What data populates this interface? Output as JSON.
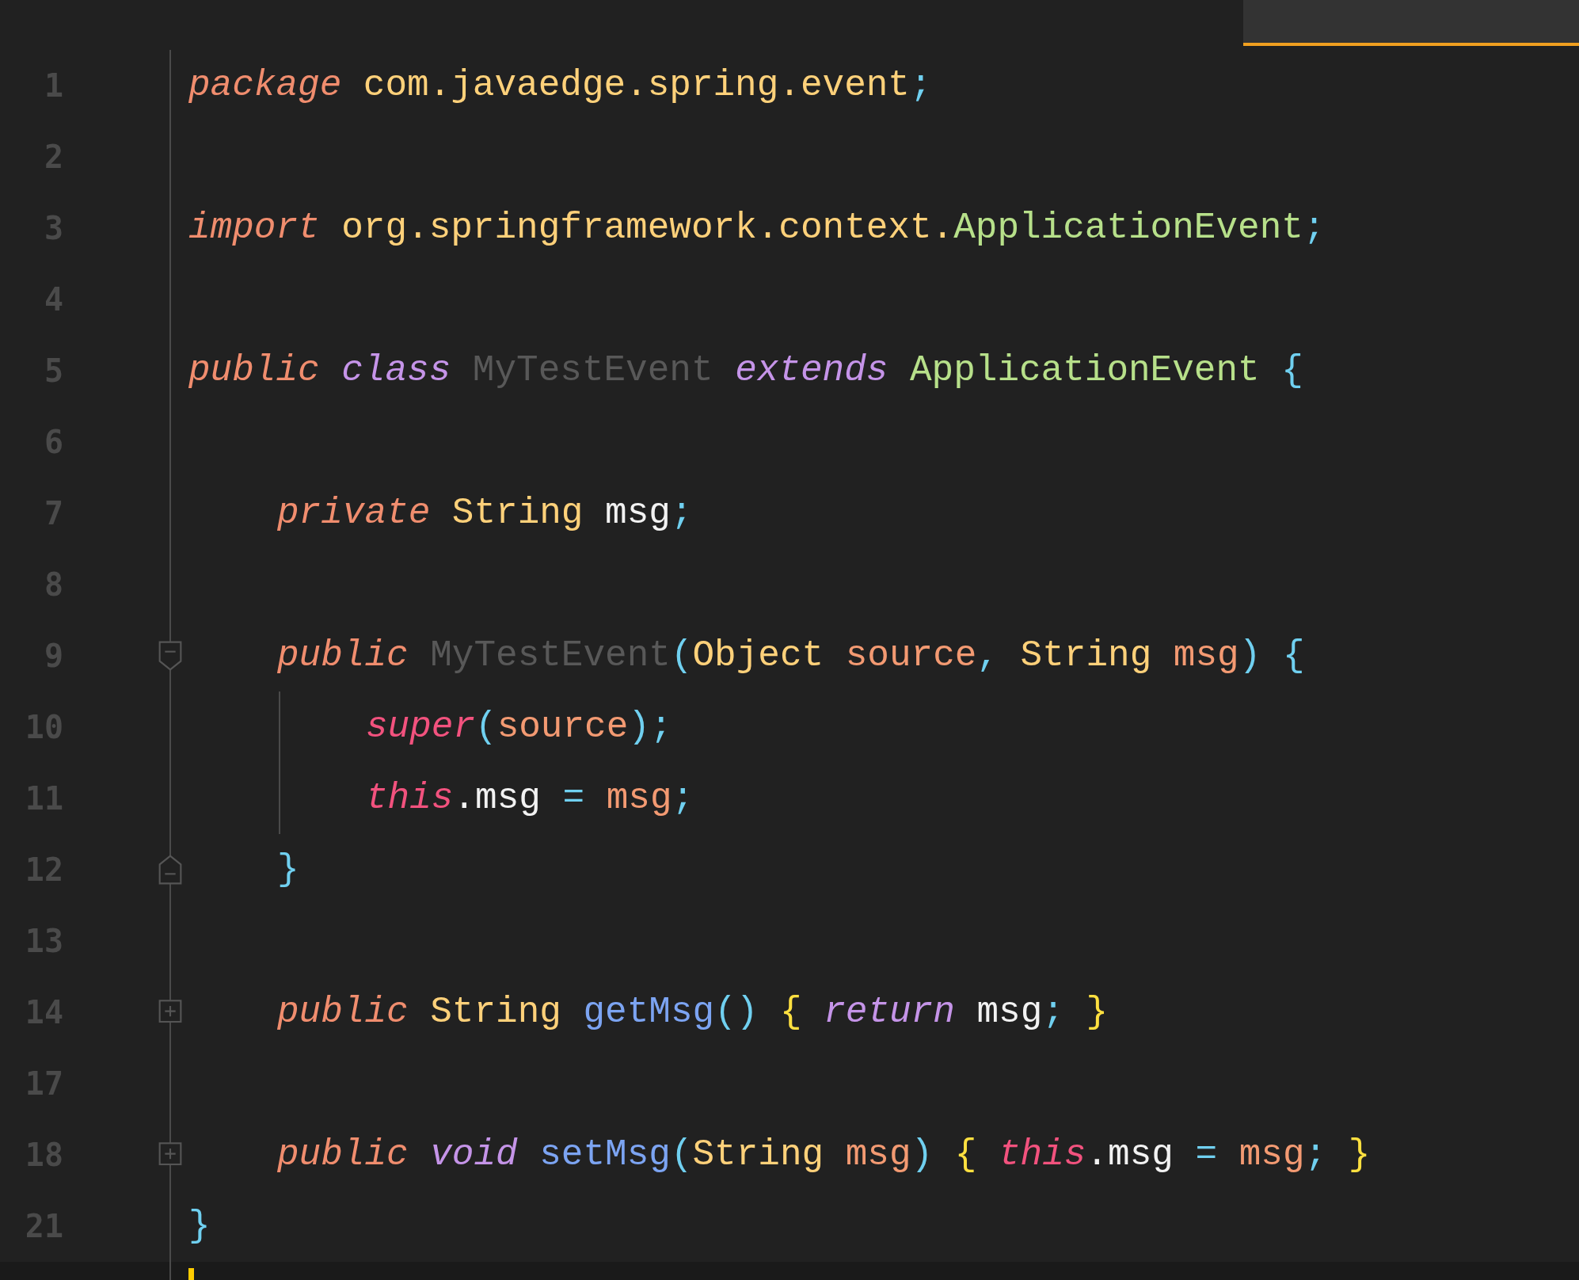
{
  "tab": {
    "selected": true
  },
  "lines": [
    {
      "number": "1",
      "tokens": [
        {
          "text": "package",
          "kind": "keyword"
        },
        {
          "text": " com.javaedge.spring.event",
          "kind": "type"
        },
        {
          "text": ";",
          "kind": "punct"
        }
      ]
    },
    {
      "number": "2"
    },
    {
      "number": "3",
      "tokens": [
        {
          "text": "import",
          "kind": "keyword"
        },
        {
          "text": " org.springframework.context.",
          "kind": "type"
        },
        {
          "text": "ApplicationEvent",
          "kind": "type-green"
        },
        {
          "text": ";",
          "kind": "punct"
        }
      ]
    },
    {
      "number": "4"
    },
    {
      "number": "5",
      "tokens": [
        {
          "text": "public ",
          "kind": "keyword"
        },
        {
          "text": "class",
          "kind": "modifier"
        },
        {
          "text": " MyTestEvent ",
          "kind": "dim"
        },
        {
          "text": "extends",
          "kind": "modifier"
        },
        {
          "text": " ApplicationEvent ",
          "kind": "type-green"
        },
        {
          "text": "{",
          "kind": "punct"
        }
      ],
      "children": [
        {
          "number": "6"
        },
        {
          "number": "7",
          "tokens": [
            {
              "text": "private",
              "kind": "keyword"
            },
            {
              "text": " String ",
              "kind": "type"
            },
            {
              "text": "msg",
              "kind": "field"
            },
            {
              "text": ";",
              "kind": "punct"
            }
          ]
        },
        {
          "number": "8"
        },
        {
          "number": "9",
          "kind": "fold-start",
          "tokens": [
            {
              "text": "public",
              "kind": "keyword"
            },
            {
              "text": " MyTestEvent",
              "kind": "dim"
            },
            {
              "text": "(",
              "kind": "punct"
            },
            {
              "text": "Object ",
              "kind": "type"
            },
            {
              "text": "source",
              "kind": "param"
            },
            {
              "text": ", ",
              "kind": "punct"
            },
            {
              "text": "String ",
              "kind": "type"
            },
            {
              "text": "msg",
              "kind": "param"
            },
            {
              "text": ") {",
              "kind": "punct"
            }
          ],
          "children": [
            {
              "number": "10",
              "tokens": [
                {
                  "text": "super",
                  "kind": "self"
                },
                {
                  "text": "(",
                  "kind": "punct"
                },
                {
                  "text": "source",
                  "kind": "param"
                },
                {
                  "text": ");",
                  "kind": "punct"
                }
              ]
            },
            {
              "number": "11",
              "tokens": [
                {
                  "text": "this",
                  "kind": "self"
                },
                {
                  "text": ".msg ",
                  "kind": "field"
                },
                {
                  "text": "= ",
                  "kind": "punct"
                },
                {
                  "text": "msg",
                  "kind": "param"
                },
                {
                  "text": ";",
                  "kind": "punct"
                }
              ]
            }
          ]
        },
        {
          "number": "12",
          "kind": "fold-end",
          "tokens": [
            {
              "text": "}",
              "kind": "punct"
            }
          ]
        },
        {
          "number": "13"
        },
        {
          "number": "14",
          "kind": "folded",
          "tokens": [
            {
              "text": "public",
              "kind": "keyword"
            },
            {
              "text": " String ",
              "kind": "type"
            },
            {
              "text": "getMsg",
              "kind": "method"
            },
            {
              "text": "() ",
              "kind": "punct"
            },
            {
              "text": "{ ",
              "kind": "brace"
            },
            {
              "text": "return",
              "kind": "modifier"
            },
            {
              "text": " msg",
              "kind": "field"
            },
            {
              "text": "; ",
              "kind": "punct"
            },
            {
              "text": "}",
              "kind": "brace"
            }
          ]
        },
        {
          "number": "17"
        },
        {
          "number": "18",
          "kind": "folded",
          "tokens": [
            {
              "text": "public ",
              "kind": "keyword"
            },
            {
              "text": "void",
              "kind": "modifier"
            },
            {
              "text": " setMsg",
              "kind": "method"
            },
            {
              "text": "(",
              "kind": "punct"
            },
            {
              "text": "String ",
              "kind": "type"
            },
            {
              "text": "msg",
              "kind": "param"
            },
            {
              "text": ") ",
              "kind": "punct"
            },
            {
              "text": "{ ",
              "kind": "brace"
            },
            {
              "text": "this",
              "kind": "self"
            },
            {
              "text": ".msg ",
              "kind": "field"
            },
            {
              "text": "= ",
              "kind": "punct"
            },
            {
              "text": "msg",
              "kind": "param"
            },
            {
              "text": "; ",
              "kind": "punct"
            },
            {
              "text": "}",
              "kind": "brace"
            }
          ]
        }
      ]
    },
    {
      "number": "21",
      "tokens": [
        {
          "text": "}",
          "kind": "punct"
        }
      ]
    }
  ],
  "cursor_line": {
    "current": true
  }
}
